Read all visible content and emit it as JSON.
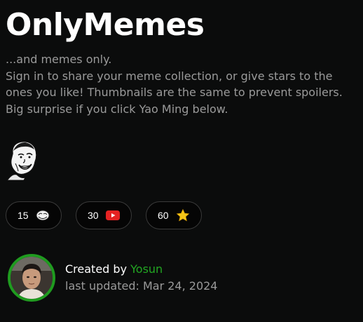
{
  "header": {
    "title": "OnlyMemes"
  },
  "description": {
    "lines": [
      "...and memes only.",
      "Sign in to share your meme collection, or give stars to the",
      "ones you like! Thumbnails are the same to prevent spoilers.",
      "Big surprise if you click Yao Ming below."
    ]
  },
  "stats": [
    {
      "count": "15",
      "icon": "troll-face-icon"
    },
    {
      "count": "30",
      "icon": "youtube-icon"
    },
    {
      "count": "60",
      "icon": "star-icon"
    }
  ],
  "creator": {
    "prefix": "Created by ",
    "name": "Yosun",
    "updated": "last updated: Mar 24, 2024"
  },
  "colors": {
    "background": "#0b0c0c",
    "accent_green": "#22a722",
    "avatar_ring": "#1f9b1f",
    "youtube_red": "#e52222",
    "star_gold": "#f5c518"
  }
}
